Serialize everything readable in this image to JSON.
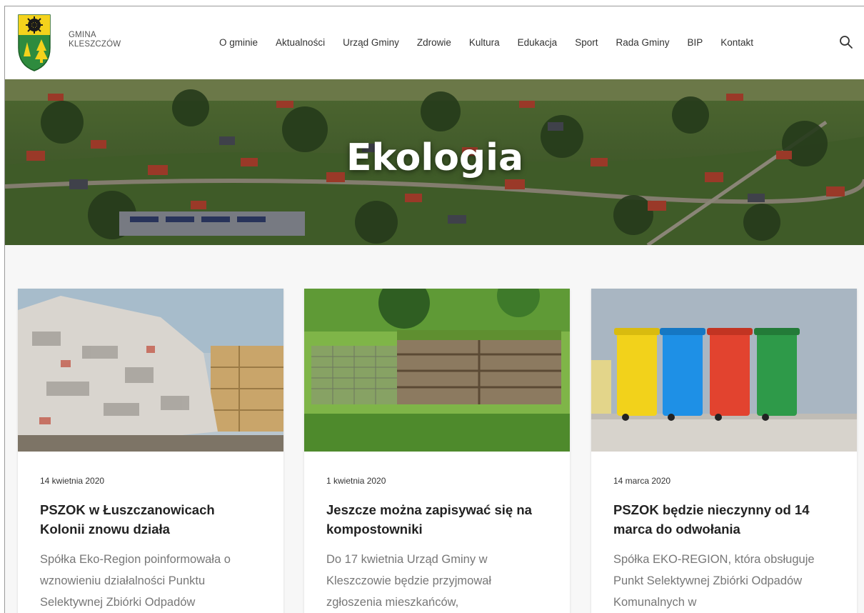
{
  "brand": {
    "line1": "GMINA",
    "line2": "KLESZCZÓW"
  },
  "nav": {
    "items": [
      {
        "label": "O gminie"
      },
      {
        "label": "Aktualności"
      },
      {
        "label": "Urząd Gminy"
      },
      {
        "label": "Zdrowie"
      },
      {
        "label": "Kultura"
      },
      {
        "label": "Edukacja"
      },
      {
        "label": "Sport"
      },
      {
        "label": "Rada Gminy"
      },
      {
        "label": "BIP"
      },
      {
        "label": "Kontakt"
      }
    ],
    "search_icon": "search-icon"
  },
  "hero": {
    "title": "Ekologia"
  },
  "posts": [
    {
      "date": "14 kwietnia 2020",
      "title": "PSZOK w Łuszczanowicach Kolonii znowu działa",
      "excerpt": "Spółka Eko-Region poinformowała o wznowieniu działalności Punktu Selektywnej Zbiórki Odpadów"
    },
    {
      "date": "1 kwietnia 2020",
      "title": "Jeszcze można zapisywać się na kompostowniki",
      "excerpt": "Do 17 kwietnia Urząd Gminy w Kleszczowie będzie przyjmował zgłoszenia mieszkańców,"
    },
    {
      "date": "14 marca 2020",
      "title": "PSZOK będzie nieczynny od 14 marca do odwołania",
      "excerpt": "Spółka EKO-REGION, która obsługuje Punkt Selektywnej Zbiórki Odpadów Komunalnych w"
    }
  ],
  "colors": {
    "page_bg": "#f7f7f7",
    "text_dark": "#222222",
    "text_muted": "#777777",
    "bin_colors": [
      "#f2d21b",
      "#1e90e6",
      "#e2432f",
      "#2e9a49"
    ]
  }
}
